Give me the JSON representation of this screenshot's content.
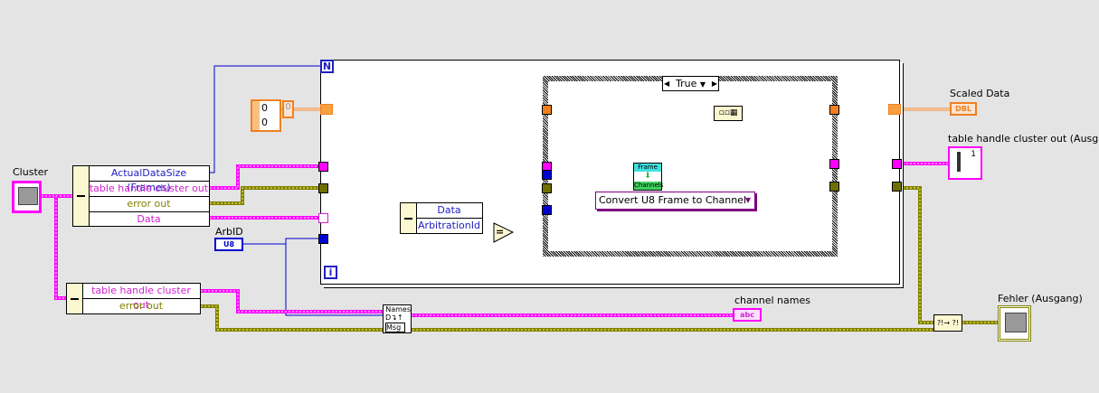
{
  "inputs": {
    "cluster_label": "Cluster",
    "arbid_label": "ArbID",
    "arbid_type": "U8"
  },
  "unbundle_main": {
    "rows": [
      "ActualDataSize (Frames)",
      "table handle cluster out",
      "error out",
      "Data"
    ]
  },
  "unbundle_secondary": {
    "rows": [
      "table handle cluster out",
      "error out"
    ]
  },
  "array_constant": {
    "values": [
      "0",
      "0"
    ],
    "index": "0"
  },
  "for_loop": {
    "count_terminal": "N",
    "iteration_terminal": "i"
  },
  "unbundle_inner": {
    "rows": [
      "Data",
      "ArbitrationId"
    ]
  },
  "equal_node": "=",
  "case_structure": {
    "selector_value": "True"
  },
  "subvi": {
    "top": "Frame",
    "bottom": "Channels",
    "ring_label": "Convert U8 Frame to Channel"
  },
  "names_node": {
    "top": "Names",
    "bottom": "Msg"
  },
  "outputs": {
    "scaled_data_label": "Scaled Data",
    "scaled_data_type": "DBL",
    "table_handle_label": "table handle cluster out (Ausgang)",
    "table_handle_index": "1",
    "channel_names_label": "channel names",
    "channel_names_type": "abc",
    "error_out_label": "Fehler (Ausgang)"
  },
  "colors": {
    "cluster_wire": "#ff00ff",
    "error_wire": "#808000",
    "dbl_wire": "#f08020",
    "int_wire": "#0000d0",
    "canvas": "#e4e4e4"
  }
}
